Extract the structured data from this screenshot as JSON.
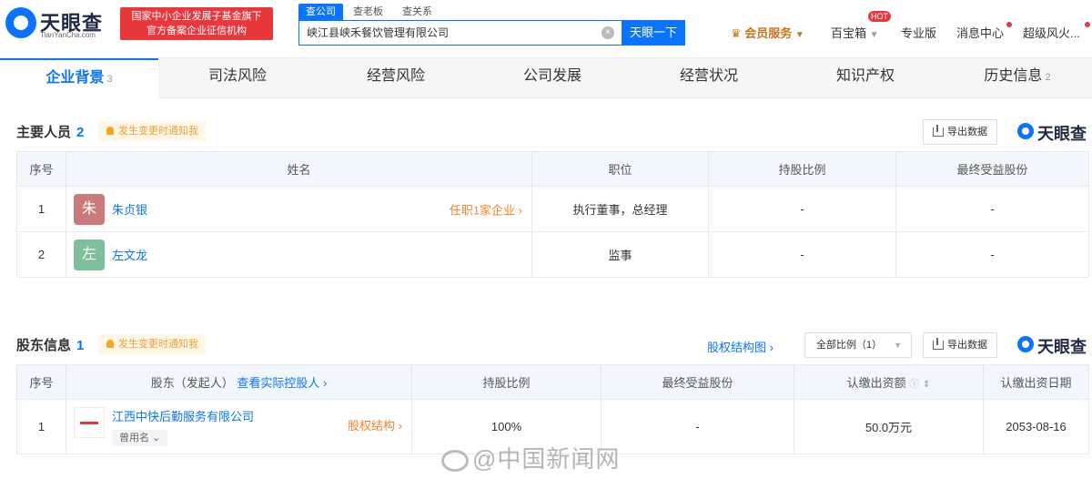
{
  "header": {
    "logo_text": "天眼查",
    "logo_sub": "TianYanCha.com",
    "red_tag_line1": "国家中小企业发展子基金旗下",
    "red_tag_line2": "官方备案企业征信机构",
    "search_tabs": [
      "查公司",
      "查老板",
      "查关系"
    ],
    "search_value": "峡江县峡禾餐饮管理有限公司",
    "search_button": "天眼一下",
    "nav": {
      "vip": "会员服务",
      "baibaoxiang": "百宝箱",
      "hot": "HOT",
      "pro": "专业版",
      "messages": "消息中心",
      "user": "超级风火..."
    }
  },
  "tabs": [
    {
      "label": "企业背景",
      "count": "3"
    },
    {
      "label": "司法风险",
      "count": ""
    },
    {
      "label": "经营风险",
      "count": ""
    },
    {
      "label": "公司发展",
      "count": ""
    },
    {
      "label": "经营状况",
      "count": ""
    },
    {
      "label": "知识产权",
      "count": ""
    },
    {
      "label": "历史信息",
      "count": "2"
    }
  ],
  "personnel": {
    "title": "主要人员",
    "count": "2",
    "notify": "发生变更时通知我",
    "export": "导出数据",
    "brand": "天眼查",
    "headers": [
      "序号",
      "姓名",
      "职位",
      "持股比例",
      "最终受益股份"
    ],
    "rows": [
      {
        "no": "1",
        "avatar_char": "朱",
        "avatar_color": "#c97b7b",
        "name": "朱贞银",
        "link": "任职1家企业 ›",
        "position": "执行董事，总经理",
        "share": "-",
        "benefit": "-"
      },
      {
        "no": "2",
        "avatar_char": "左",
        "avatar_color": "#7dbf9a",
        "name": "左文龙",
        "link": "",
        "position": "监事",
        "share": "-",
        "benefit": "-"
      }
    ]
  },
  "shareholders": {
    "title": "股东信息",
    "count": "1",
    "notify": "发生变更时通知我",
    "structure_link": "股权结构图 ›",
    "ratio_dropdown": "全部比例（1）",
    "export": "导出数据",
    "brand": "天眼查",
    "headers": {
      "no": "序号",
      "holder": "股东（发起人）",
      "holder_link": "查看实际控股人 ›",
      "ratio": "持股比例",
      "benefit": "最终受益股份",
      "capital": "认缴出资额",
      "date": "认缴出资日期"
    },
    "rows": [
      {
        "no": "1",
        "name": "江西中快后勤服务有限公司",
        "tag": "曾用名 ⌄",
        "link": "股权结构 ›",
        "ratio": "100%",
        "benefit": "-",
        "capital": "50.0万元",
        "date": "2053-08-16"
      }
    ]
  },
  "watermark": "@中国新闻网"
}
